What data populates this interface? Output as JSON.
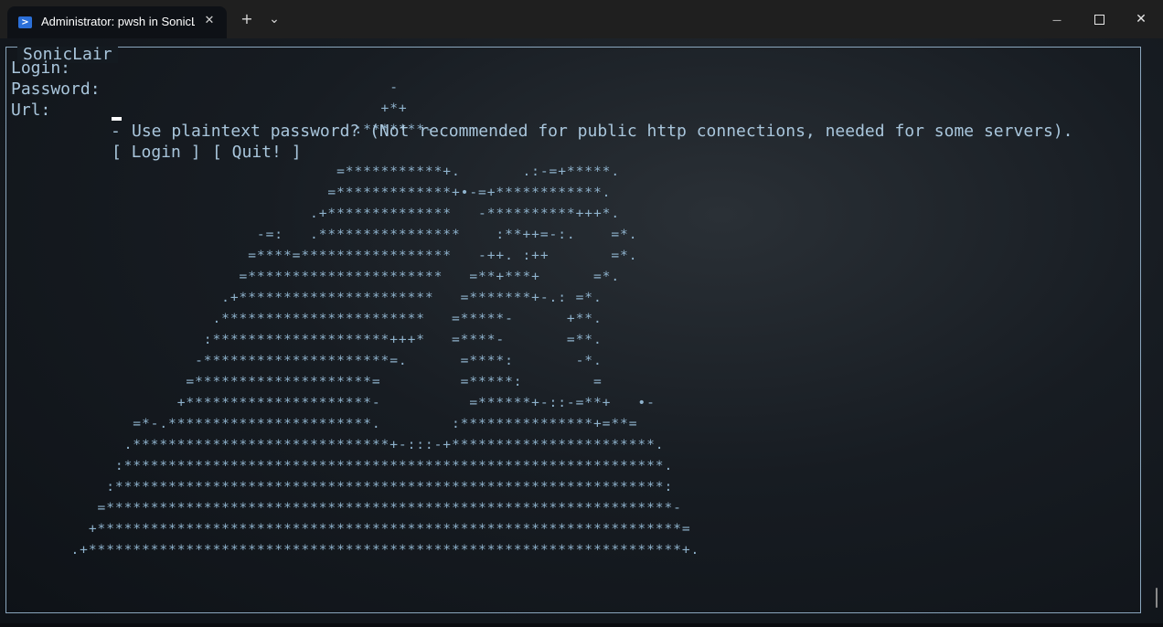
{
  "window": {
    "tab_title": "Administrator: pwsh in SonicL",
    "tab_close": "✕",
    "new_tab": "+",
    "dropdown": "⌄",
    "minimize": "—",
    "close": "✕"
  },
  "terminal": {
    "frame_title": "SonicLair",
    "login_label": "Login:",
    "password_label": "Password:",
    "url_label": "Url:",
    "plaintext_checkbox": "-",
    "plaintext_label": "Use plaintext password? (Not recommended for public http connections, needed for some servers).",
    "login_button": "[ Login ]",
    "quit_button": "[ Quit! ]"
  },
  "art": {
    "lines": [
      "                                            -",
      "                                           +*+",
      "                                        :*******-",
      "",
      "                                      =***********+.       .:-=+*****.",
      "                                     =*************+•-=+************.",
      "                                   .+**************   -**********+++*.",
      "                             -=:   .****************    :**++=-:.    =*.",
      "                            =****=*****************   -++. :++       =*.",
      "                           =**********************   =**+***+      =*.",
      "                         .+**********************   =*******+-.: =*.",
      "                        .***********************   =*****-      +**.",
      "                       :********************+++*   =****-       =**.",
      "                      -*********************=.      =****:       -*.",
      "                     =********************=         =*****:        =",
      "                    +*********************-          =******+-::-=**+   •-",
      "               =*-.***********************.        :***************+=**=",
      "              .*****************************+-:::-+***********************.",
      "             :*************************************************************.",
      "            :**************************************************************:",
      "           =****************************************************************-",
      "          +******************************************************************=",
      "        .+*******************************************************************+."
    ]
  }
}
